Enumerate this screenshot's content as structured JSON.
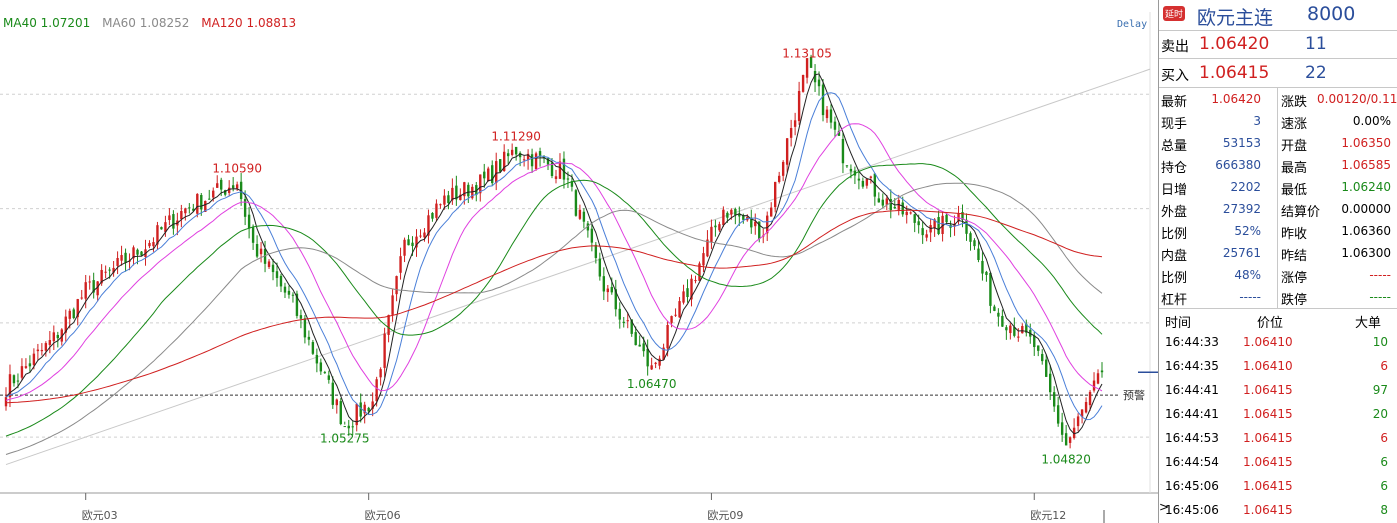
{
  "legend": {
    "ma40": "MA40 1.07201",
    "ma60": "MA60 1.08252",
    "ma120": "MA120 1.08813",
    "delay": "Delay"
  },
  "colors": {
    "up": "#d02020",
    "down": "#1a8a1a",
    "ma5": "#222222",
    "ma10": "#4a7fd8",
    "ma20": "#e040e0",
    "ma40": "#1a8a1a",
    "ma60": "#8a8a8a",
    "ma120": "#d02020",
    "trendline": "#c8c8c8",
    "panelBlue": "#2b4e9b"
  },
  "chart_data": {
    "type": "candlestick",
    "ylim": [
      1.038,
      1.143
    ],
    "x_tick_labels": [
      "欧元03",
      "欧元06",
      "欧元09",
      "欧元12"
    ],
    "x_tick_positions": [
      20,
      91,
      177,
      258
    ],
    "num_bars": 276,
    "price_labels": [
      {
        "text": "1.10590",
        "bar": 58,
        "price": 1.1059,
        "pos": "above"
      },
      {
        "text": "1.05275",
        "bar": 85,
        "price": 1.05275,
        "pos": "below"
      },
      {
        "text": "1.11290",
        "bar": 128,
        "price": 1.1129,
        "pos": "above"
      },
      {
        "text": "1.06470",
        "bar": 162,
        "price": 1.0647,
        "pos": "below"
      },
      {
        "text": "1.13105",
        "bar": 201,
        "price": 1.13105,
        "pos": "above"
      },
      {
        "text": "1.04820",
        "bar": 266,
        "price": 1.0482,
        "pos": "below"
      }
    ],
    "pivots": [
      [
        0,
        1.061
      ],
      [
        12,
        1.0715
      ],
      [
        20,
        1.082
      ],
      [
        35,
        1.092
      ],
      [
        45,
        1.1
      ],
      [
        58,
        1.1059
      ],
      [
        62,
        1.092
      ],
      [
        72,
        1.079
      ],
      [
        85,
        1.05275
      ],
      [
        92,
        1.058
      ],
      [
        100,
        1.092
      ],
      [
        110,
        1.102
      ],
      [
        120,
        1.106
      ],
      [
        128,
        1.1129
      ],
      [
        140,
        1.108
      ],
      [
        150,
        1.083
      ],
      [
        162,
        1.0647
      ],
      [
        170,
        1.08
      ],
      [
        180,
        1.1
      ],
      [
        190,
        1.095
      ],
      [
        201,
        1.13105
      ],
      [
        210,
        1.112
      ],
      [
        220,
        1.102
      ],
      [
        232,
        1.095
      ],
      [
        240,
        1.099
      ],
      [
        248,
        1.078
      ],
      [
        258,
        1.07
      ],
      [
        266,
        1.0482
      ],
      [
        275,
        1.0642
      ]
    ],
    "alert_price": 1.0592,
    "alert_label": "预警",
    "last_price": 1.0642,
    "trendline": {
      "start": [
        0,
        1.044
      ],
      "end": [
        282,
        1.1305
      ]
    }
  },
  "panel": {
    "title": {
      "tag": "延时",
      "name": "欧元主连",
      "code": "8000"
    },
    "ask": {
      "label": "卖出",
      "price": "1.06420",
      "vol": "11"
    },
    "bid": {
      "label": "买入",
      "price": "1.06415",
      "vol": "22"
    },
    "stats": [
      {
        "l1": "最新",
        "v1": "1.06420",
        "c1": "red",
        "l2": "涨跌",
        "v2": "0.00120/0.11%",
        "c2": "red"
      },
      {
        "l1": "现手",
        "v1": "3",
        "c1": "blue",
        "l2": "速涨",
        "v2": "0.00%",
        "c2": "black"
      },
      {
        "l1": "总量",
        "v1": "53153",
        "c1": "blue",
        "l2": "开盘",
        "v2": "1.06350",
        "c2": "red"
      },
      {
        "l1": "持仓",
        "v1": "666380",
        "c1": "blue",
        "l2": "最高",
        "v2": "1.06585",
        "c2": "red"
      },
      {
        "l1": "日增",
        "v1": "2202",
        "c1": "blue",
        "l2": "最低",
        "v2": "1.06240",
        "c2": "green"
      },
      {
        "l1": "外盘",
        "v1": "27392",
        "c1": "blue",
        "l2": "结算价",
        "v2": "0.00000",
        "c2": "black"
      },
      {
        "l1": "比例",
        "v1": "52%",
        "c1": "blue",
        "l2": "昨收",
        "v2": "1.06360",
        "c2": "black"
      },
      {
        "l1": "内盘",
        "v1": "25761",
        "c1": "blue",
        "l2": "昨结",
        "v2": "1.06300",
        "c2": "black"
      },
      {
        "l1": "比例",
        "v1": "48%",
        "c1": "blue",
        "l2": "涨停",
        "v2": "-----",
        "c2": "red"
      },
      {
        "l1": "杠杆",
        "v1": "-----",
        "c1": "blue",
        "l2": "跌停",
        "v2": "-----",
        "c2": "green"
      }
    ],
    "ticks_header": {
      "time": "时间",
      "price": "价位",
      "big": "大单"
    },
    "ticks": [
      {
        "time": "16:44:33",
        "price": "1.06410",
        "vol": "10",
        "c": "green"
      },
      {
        "time": "16:44:35",
        "price": "1.06410",
        "vol": "6",
        "c": "red"
      },
      {
        "time": "16:44:41",
        "price": "1.06415",
        "vol": "97",
        "c": "green"
      },
      {
        "time": "16:44:41",
        "price": "1.06415",
        "vol": "20",
        "c": "green"
      },
      {
        "time": "16:44:53",
        "price": "1.06415",
        "vol": "6",
        "c": "red"
      },
      {
        "time": "16:44:54",
        "price": "1.06415",
        "vol": "6",
        "c": "green"
      },
      {
        "time": "16:45:06",
        "price": "1.06415",
        "vol": "6",
        "c": "green"
      },
      {
        "time": "16:45:06",
        "price": "1.06415",
        "vol": "8",
        "c": "green"
      }
    ]
  }
}
